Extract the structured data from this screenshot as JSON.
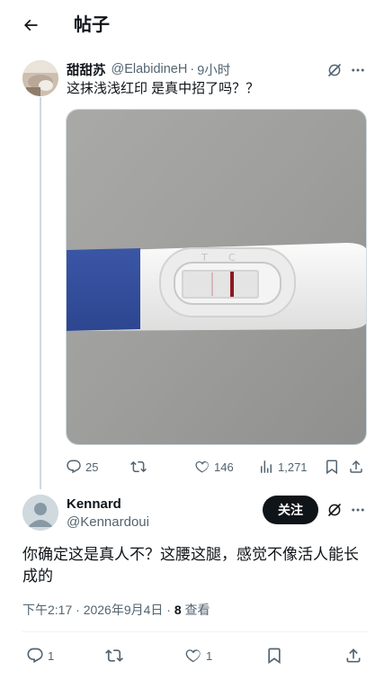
{
  "header": {
    "title": "帖子"
  },
  "post": {
    "display_name": "甜甜苏",
    "handle": "@ElabidineH",
    "separator": "·",
    "time": "9小时",
    "text": "这抹浅浅红印 是真中招了吗？？",
    "media": {
      "test_labels": [
        "T",
        "C"
      ]
    },
    "stats": {
      "replies": "25",
      "reposts": "",
      "likes": "146",
      "views": "1,271"
    }
  },
  "reply": {
    "display_name": "Kennard",
    "handle": "@Kennardoui",
    "follow_label": "关注",
    "text": "你确定这是真人不？这腰这腿，感觉不像活人能长成的",
    "timestamp": "下午2:17 · 2026年9月4日 · ",
    "views_count": "8",
    "views_label": " 查看",
    "stats": {
      "replies": "1",
      "reposts": "",
      "likes": "1"
    }
  },
  "colors": {
    "text_primary": "#0f1419",
    "text_secondary": "#536471",
    "thread_line": "#cfd9de",
    "follow_button": "#0f1419"
  }
}
